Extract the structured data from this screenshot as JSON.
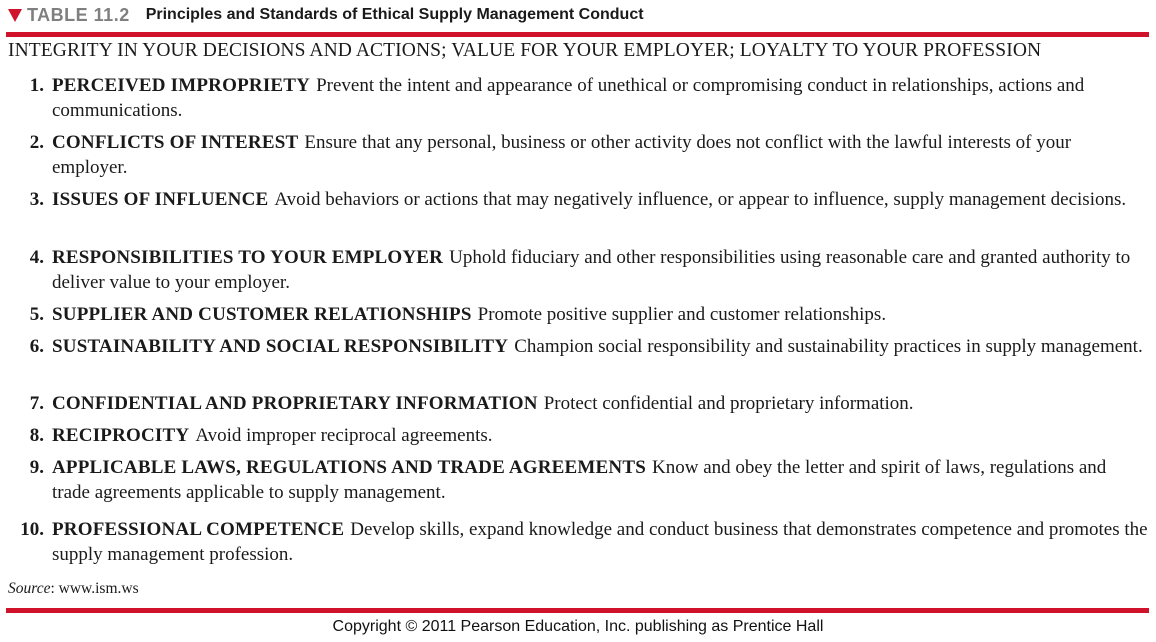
{
  "header": {
    "table_label": "TABLE 11.2",
    "title": "Principles and Standards of Ethical Supply Management Conduct",
    "marker_icon": "triangle-down-icon",
    "accent_color": "#d1122b"
  },
  "subheader": "INTEGRITY IN YOUR DECISIONS AND ACTIONS; VALUE FOR YOUR EMPLOYER; LOYALTY TO YOUR PROFESSION",
  "items": [
    {
      "number": "1.",
      "heading": "PERCEIVED IMPROPRIETY",
      "text": "Prevent the intent and appearance of unethical or compromising conduct in relationships, actions and communications."
    },
    {
      "number": "2.",
      "heading": "CONFLICTS OF INTEREST",
      "text": "Ensure that any personal, business or other activity does not conflict with the lawful interests of your employer."
    },
    {
      "number": "3.",
      "heading": "ISSUES OF INFLUENCE",
      "text": "Avoid behaviors or actions that may negatively influence, or appear to influence, supply management decisions."
    },
    {
      "number": "4.",
      "heading": "RESPONSIBILITIES TO YOUR EMPLOYER",
      "text": "Uphold fiduciary and other responsibilities using reasonable care and granted authority to deliver value to your employer."
    },
    {
      "number": "5.",
      "heading": "SUPPLIER AND CUSTOMER RELATIONSHIPS",
      "text": "Promote positive supplier and customer relationships."
    },
    {
      "number": "6.",
      "heading": "SUSTAINABILITY AND SOCIAL RESPONSIBILITY",
      "text": "Champion social responsibility and sustainability practices in supply management."
    },
    {
      "number": "7.",
      "heading": "CONFIDENTIAL AND PROPRIETARY INFORMATION",
      "text": "Protect confidential and proprietary information."
    },
    {
      "number": "8.",
      "heading": "RECIPROCITY",
      "text": "Avoid improper reciprocal agreements."
    },
    {
      "number": "9.",
      "heading": "APPLICABLE LAWS, REGULATIONS AND TRADE AGREEMENTS",
      "text": "Know and obey the letter and spirit of laws, regulations and trade agreements applicable to supply management."
    },
    {
      "number": "10.",
      "heading": "PROFESSIONAL COMPETENCE",
      "text": "Develop skills, expand knowledge and conduct business that demonstrates competence and promotes the supply management profession."
    }
  ],
  "source": {
    "label": "Source",
    "separator": ":",
    "value": "www.ism.ws"
  },
  "copyright": "Copyright © 2011 Pearson Education, Inc. publishing as Prentice Hall"
}
